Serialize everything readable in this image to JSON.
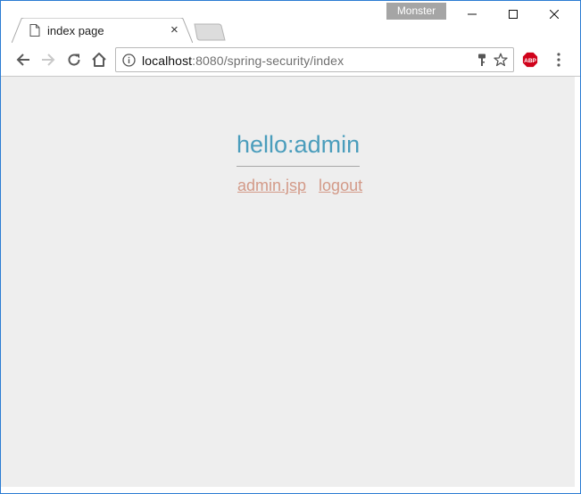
{
  "window": {
    "profile_name": "Monster",
    "controls": {
      "minimize": "minimize-icon",
      "maximize": "maximize-icon",
      "close": "close-icon"
    }
  },
  "tabs": [
    {
      "title": "index page",
      "icon": "page-icon",
      "close": "×"
    }
  ],
  "toolbar": {
    "address": {
      "host": "localhost",
      "rest": ":8080/spring-security/index"
    }
  },
  "page": {
    "greeting": "hello:admin",
    "links": [
      {
        "label": "admin.jsp"
      },
      {
        "label": "logout"
      }
    ]
  },
  "colors": {
    "greeting": "#4a9dbc",
    "link": "#d39a88",
    "content_bg": "#eeeeee",
    "profile_badge": "#a5a5a5"
  }
}
